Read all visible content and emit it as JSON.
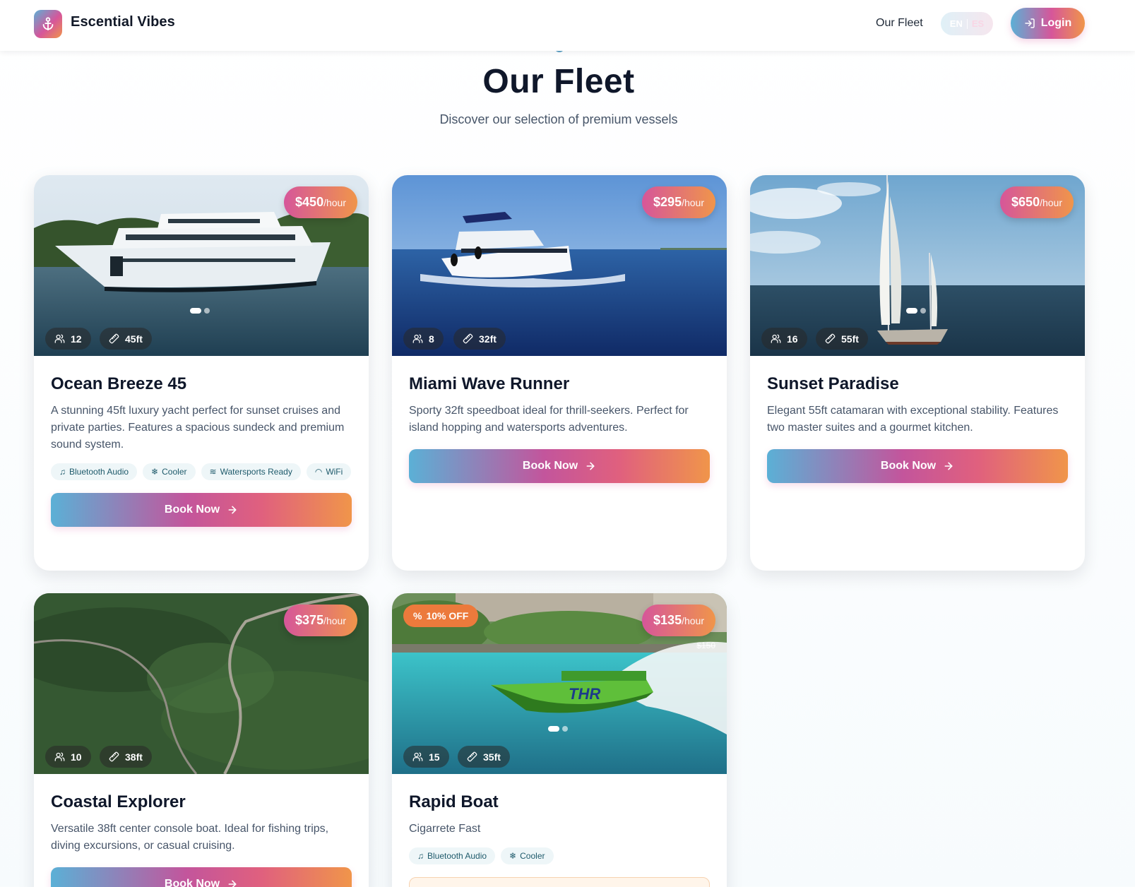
{
  "header": {
    "brand": "Escential Vibes",
    "nav_fleet": "Our Fleet",
    "lang_en": "EN",
    "lang_es": "ES",
    "login_label": "Login"
  },
  "hero": {
    "title": "Our Fleet",
    "subtitle": "Discover our selection of premium vessels"
  },
  "colors": {
    "accent_blue": "#5bb0d6",
    "accent_pink": "#d6569a",
    "accent_orange": "#f0954a",
    "discount_orange": "#ec7a3c"
  },
  "icons": {
    "logo": "anchor-icon",
    "login": "log-in-icon",
    "guests": "users-icon",
    "length": "ruler-icon",
    "book": "arrow-right-icon",
    "discount": "percent-icon",
    "audio": "music-icon",
    "cooler": "snowflake-icon",
    "watersports": "waves-icon",
    "wifi": "wifi-icon"
  },
  "boats": [
    {
      "name": "Ocean Breeze 45",
      "description": "A stunning 45ft luxury yacht perfect for sunset cruises and private parties. Features a spacious sundeck and premium sound system.",
      "price": "$450",
      "unit": "/hour",
      "guests": "12",
      "length": "45ft",
      "features": [
        "Bluetooth Audio",
        "Cooler",
        "Watersports Ready",
        "WiFi"
      ],
      "book_label": "Book Now"
    },
    {
      "name": "Miami Wave Runner",
      "description": "Sporty 32ft speedboat ideal for thrill-seekers. Perfect for island hopping and watersports adventures.",
      "price": "$295",
      "unit": "/hour",
      "guests": "8",
      "length": "32ft",
      "book_label": "Book Now"
    },
    {
      "name": "Sunset Paradise",
      "description": "Elegant 55ft catamaran with exceptional stability. Features two master suites and a gourmet kitchen.",
      "price": "$650",
      "unit": "/hour",
      "guests": "16",
      "length": "55ft",
      "book_label": "Book Now"
    },
    {
      "name": "Coastal Explorer",
      "description": "Versatile 38ft center console boat. Ideal for fishing trips, diving excursions, or casual cruising.",
      "price": "$375",
      "unit": "/hour",
      "guests": "10",
      "length": "38ft",
      "book_label": "Book Now"
    },
    {
      "name": "Rapid Boat",
      "description": "Cigarrete Fast",
      "price": "$135",
      "unit": "/hour",
      "old_price": "$150",
      "discount": "10% OFF",
      "guests": "15",
      "length": "35ft",
      "features": [
        "Bluetooth Audio",
        "Cooler"
      ]
    }
  ]
}
